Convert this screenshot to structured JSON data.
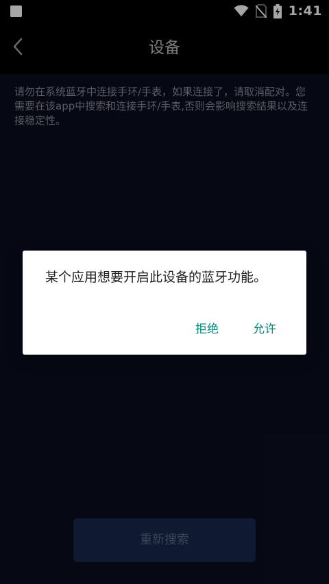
{
  "status_bar": {
    "time": "1:41",
    "icons": [
      "notification-square-icon",
      "wifi-icon",
      "no-sim-icon",
      "battery-charging-icon"
    ]
  },
  "app_bar": {
    "title": "设备",
    "back_icon": "chevron-left-icon"
  },
  "notice_text": "请勿在系统蓝牙中连接手环/手表，如果连接了，请取消配对。您需要在该app中搜索和连接手环/手表,否则会影响搜索结果以及连接稳定性。",
  "research_button_label": "重新搜索",
  "dialog": {
    "message": "某个应用想要开启此设备的蓝牙功能。",
    "deny_label": "拒绝",
    "allow_label": "允许"
  },
  "colors": {
    "dialog_button": "#00897b",
    "background": "#0a0e1f",
    "research_button_bg": "#14294d"
  }
}
